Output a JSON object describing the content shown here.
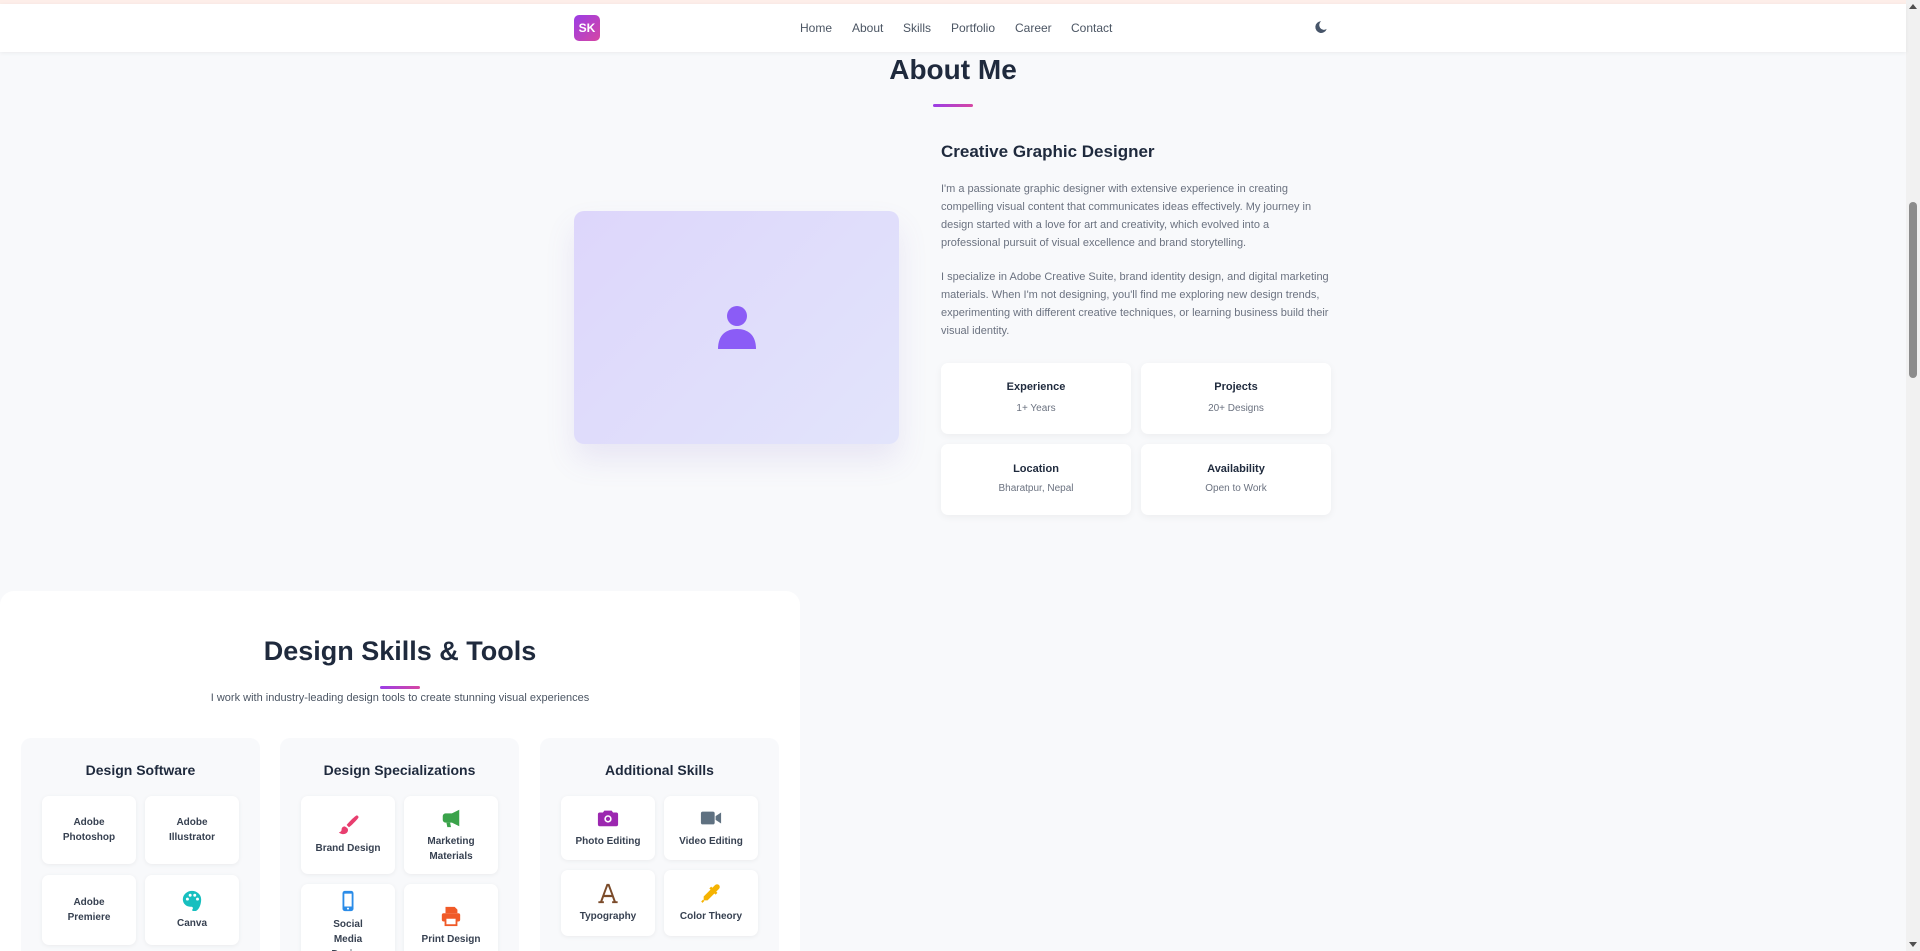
{
  "nav": {
    "logo": "SK",
    "links": [
      "Home",
      "About",
      "Skills",
      "Portfolio",
      "Career",
      "Contact"
    ],
    "theme_icon": "moon-icon"
  },
  "about": {
    "title": "About Me",
    "subtitle": "Creative Graphic Designer",
    "para1": "I'm a passionate graphic designer with extensive experience in creating compelling visual content that communicates ideas effectively. My journey in design started with a love for art and creativity, which evolved into a professional pursuit of visual excellence and brand storytelling.",
    "para2": "I specialize in Adobe Creative Suite, brand identity design, and digital marketing materials. When I'm not designing, you'll find me exploring new design trends, experimenting with different creative techniques, or learning business build their visual identity.",
    "stats": [
      {
        "label": "Experience",
        "value": "1+ Years"
      },
      {
        "label": "Projects",
        "value": "20+ Designs"
      },
      {
        "label": "Location",
        "value": "Bharatpur, Nepal"
      },
      {
        "label": "Availability",
        "value": "Open to Work"
      }
    ]
  },
  "skills": {
    "title": "Design Skills & Tools",
    "description": "I work with industry-leading design tools to create stunning visual experiences",
    "columns": [
      {
        "title": "Design Software",
        "items": [
          {
            "name": "Adobe Photoshop"
          },
          {
            "name": "Adobe Illustrator"
          },
          {
            "name": "Adobe Premiere"
          },
          {
            "name": "Canva",
            "icon": "palette-icon",
            "color": "#17bfbf"
          }
        ]
      },
      {
        "title": "Design Specializations",
        "items": [
          {
            "name": "Brand Design",
            "icon": "paintbrush-icon",
            "color": "#e83e6f"
          },
          {
            "name": "Marketing Materials",
            "icon": "megaphone-icon",
            "color": "#3aa34a"
          },
          {
            "name": "Social Media Design",
            "icon": "mobile-icon",
            "color": "#2b8ce8"
          },
          {
            "name": "Print Design",
            "icon": "printer-icon",
            "color": "#f05a28"
          }
        ]
      },
      {
        "title": "Additional Skills",
        "items": [
          {
            "name": "Photo Editing",
            "icon": "camera-icon",
            "color": "#9c27b0"
          },
          {
            "name": "Video Editing",
            "icon": "video-camera-icon",
            "color": "#5f7181"
          },
          {
            "name": "Typography",
            "icon": "font-icon",
            "color": "#7b4b2a"
          },
          {
            "name": "Color Theory",
            "icon": "eyedropper-icon",
            "color": "#f5b301"
          }
        ]
      }
    ]
  }
}
